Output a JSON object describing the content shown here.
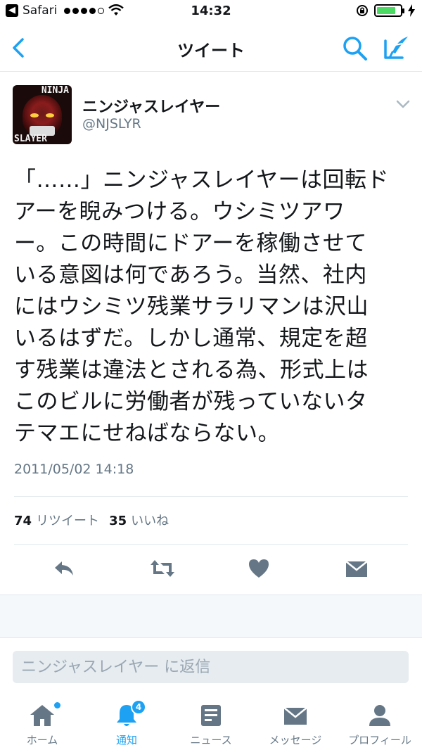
{
  "status_bar": {
    "carrier": "Safari",
    "time": "14:32"
  },
  "nav": {
    "title": "ツイート"
  },
  "tweet": {
    "display_name": "ニンジャスレイヤー",
    "handle": "@NJSLYR",
    "avatar_text_top": "NINJA",
    "avatar_text_bottom": "SLAYER",
    "lines": [
      "「……」ニンジャスレイヤーは回転ド",
      "アーを睨みつける。ウシミツアワ",
      "ー。この時間にドアーを稼働させて",
      "いる意図は何であろう。当然、社内",
      "にはウシミツ残業サラリマンは沢山",
      "いるはずだ。しかし通常、規定を超",
      "す残業は違法とされる為、形式上は",
      "このビルに労働者が残っていないタ",
      "テマエにせねばならない。"
    ],
    "timestamp": "2011/05/02 14:18",
    "retweet_count": "74",
    "retweet_label": "リツイート",
    "like_count": "35",
    "like_label": "いいね"
  },
  "reply": {
    "placeholder": "ニンジャスレイヤー に返信"
  },
  "tabs": [
    {
      "label": "ホーム",
      "icon": "home-icon"
    },
    {
      "label": "通知",
      "icon": "bell-icon",
      "badge": "4"
    },
    {
      "label": "ニュース",
      "icon": "news-icon"
    },
    {
      "label": "メッセージ",
      "icon": "envelope-icon"
    },
    {
      "label": "プロフィール",
      "icon": "person-icon"
    }
  ],
  "colors": {
    "accent": "#1da1f2",
    "secondary_text": "#657786",
    "icon_gray": "#657786",
    "battery": "#4cd964"
  },
  "battery_level": 0.8
}
